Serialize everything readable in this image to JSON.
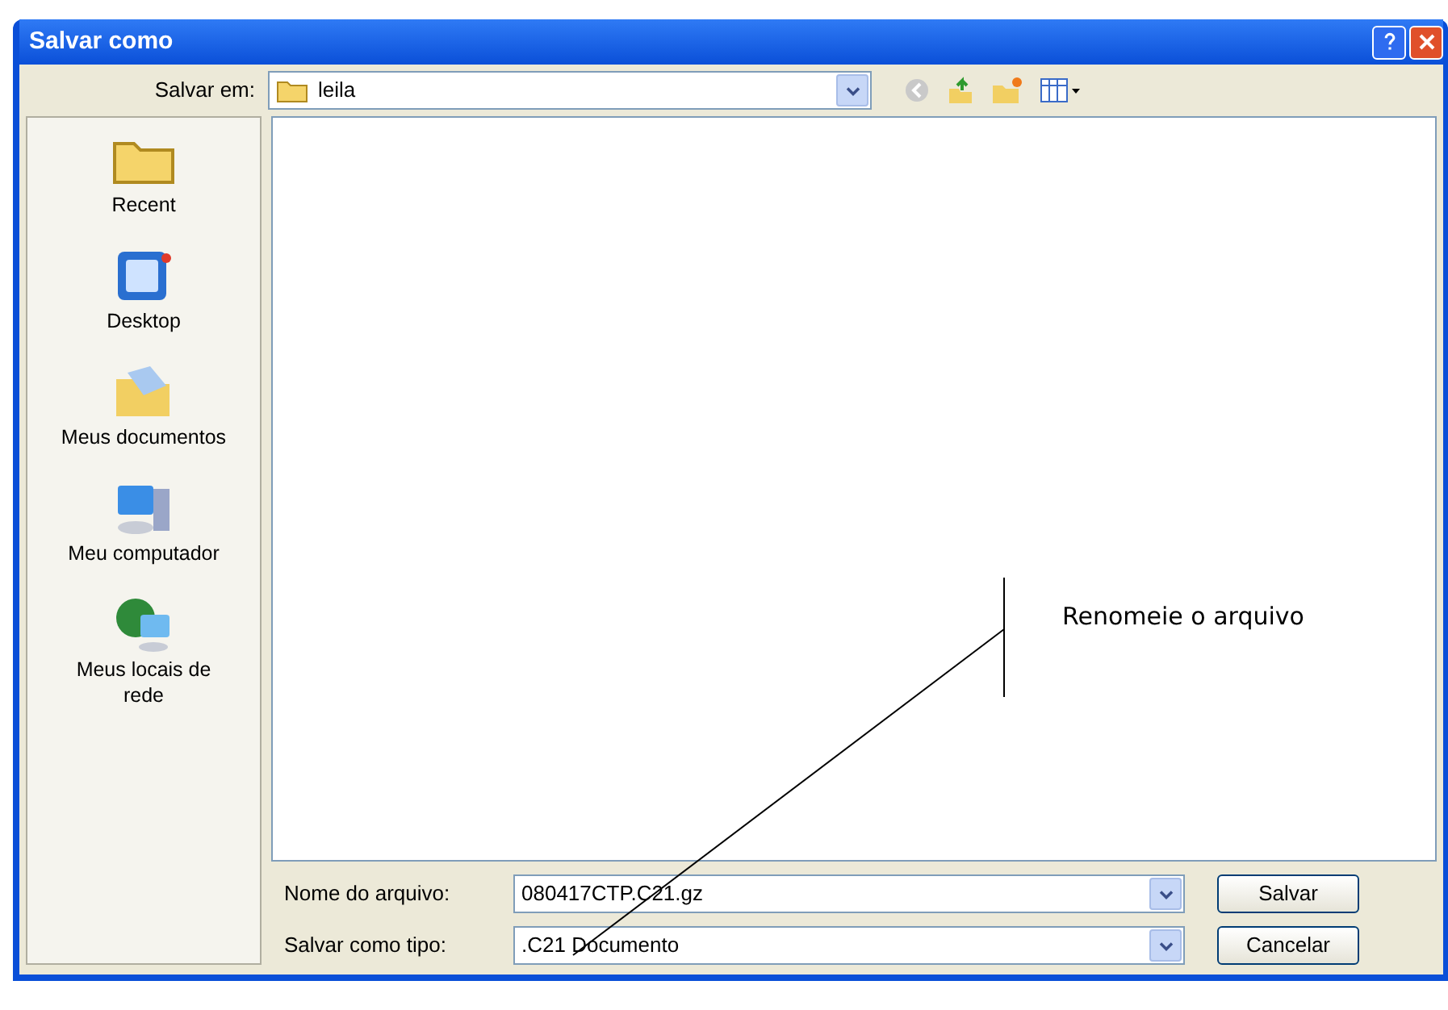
{
  "window": {
    "title": "Salvar como"
  },
  "location": {
    "label": "Salvar em:",
    "value": "leila"
  },
  "sidebar": {
    "items": [
      {
        "kind": "recent",
        "label": "Recent"
      },
      {
        "kind": "desktop",
        "label": "Desktop"
      },
      {
        "kind": "documents",
        "label": "Meus documentos"
      },
      {
        "kind": "computer",
        "label": "Meu computador"
      },
      {
        "kind": "network",
        "label": "Meus locais de rede"
      }
    ]
  },
  "fields": [
    {
      "label": "Nome do arquivo:",
      "value": "080417CTP.C21.gz"
    },
    {
      "label": "Salvar como tipo:",
      "value": ".C21 Documento"
    }
  ],
  "buttons": [
    "Salvar",
    "Cancelar"
  ],
  "annotation": {
    "text": "Renomeie o arquivo"
  }
}
